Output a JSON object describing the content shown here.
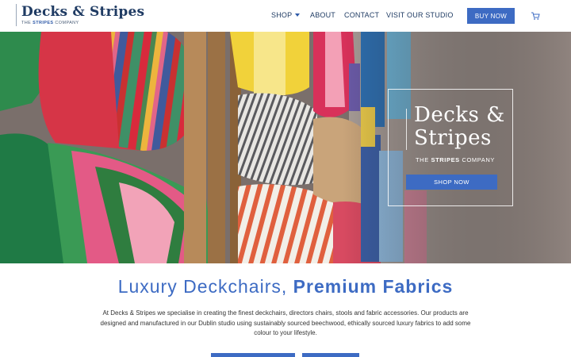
{
  "header": {
    "logo_title": "Decks & Stripes",
    "logo_sub_prefix": "THE ",
    "logo_sub_bold": "STRIPES",
    "logo_sub_suffix": " COMPANY",
    "nav": [
      {
        "label": "SHOP",
        "has_dropdown": true
      },
      {
        "label": "ABOUT"
      },
      {
        "label": "CONTACT"
      },
      {
        "label": "VISIT OUR STUDIO"
      }
    ],
    "buy_label": "BUY NOW",
    "cart_icon": "cart-icon"
  },
  "hero": {
    "title_line1": "Decks &",
    "title_line2": "Stripes",
    "sub_prefix": "THE ",
    "sub_bold": "STRIPES",
    "sub_suffix": " COMPANY",
    "cta_label": "SHOP NOW"
  },
  "content": {
    "headline_light": "Luxury Deckchairs, ",
    "headline_bold": "Premium Fabrics",
    "intro": "At Decks & Stripes we specialise in creating the finest deckchairs, directors chairs, stools and fabric accessories. Our products are designed and manufactured in our Dublin studio using sustainably sourced beechwood, ethically sourced luxury fabrics to add some colour to your lifestyle."
  },
  "colors": {
    "brand_blue": "#3d6bc3",
    "navy": "#1f3b63"
  }
}
